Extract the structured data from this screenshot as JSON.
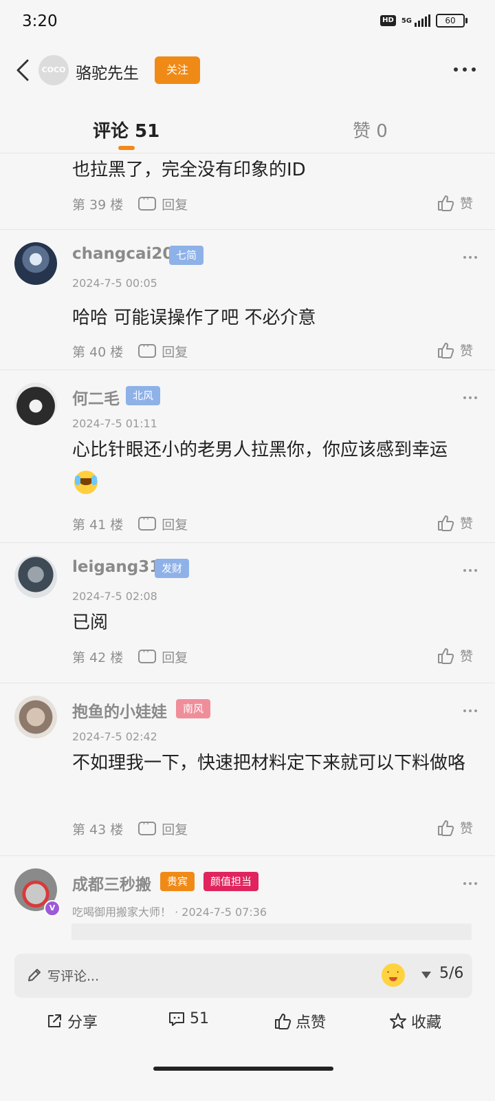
{
  "status_bar": {
    "time": "3:20",
    "hd": "HD",
    "network": "5G",
    "battery": "60"
  },
  "header": {
    "avatar_text": "COCO",
    "username": "骆驼先生",
    "follow_label": "关注"
  },
  "tabs": [
    {
      "label": "评论 51",
      "active": true
    },
    {
      "label": "赞 0",
      "active": false
    }
  ],
  "comments": [
    {
      "text": "也拉黑了，完全没有印象的ID",
      "floor": "第 39 楼",
      "reply": "回复",
      "like": "赞"
    },
    {
      "username": "changcai20",
      "badge": "七简",
      "badge_color": "#8eb1e8",
      "time": "2024-7-5 00:05",
      "text": "哈哈 可能误操作了吧 不必介意",
      "floor": "第 40 楼",
      "reply": "回复",
      "like": "赞"
    },
    {
      "username": "何二毛",
      "badge": "北风",
      "badge_color": "#8eb1e8",
      "time": "2024-7-5 01:11",
      "text": "心比针眼还小的老男人拉黑你，你应该感到幸运",
      "emoji": "laughing-tears-emoji",
      "floor": "第 41 楼",
      "reply": "回复",
      "like": "赞"
    },
    {
      "username": "leigang31",
      "badge": "发财",
      "badge_color": "#8eb1e8",
      "time": "2024-7-5 02:08",
      "text": "已阅",
      "floor": "第 42 楼",
      "reply": "回复",
      "like": "赞"
    },
    {
      "username": "抱鱼的小娃娃",
      "badge": "南风",
      "badge_color": "#ef8e9a",
      "time": "2024-7-5 02:42",
      "text": "不如理我一下，快速把材料定下来就可以下料做咯",
      "floor": "第 43 楼",
      "reply": "回复",
      "like": "赞"
    },
    {
      "username": "成都三秒搬",
      "badge": "贵宾",
      "badge_color": "#f08a16",
      "badge2": "颜值担当",
      "badge2_color": "#e0245e",
      "time": "吃喝御用搬家大师！ · 2024-7-5 07:36"
    }
  ],
  "composer": {
    "placeholder": "写评论...",
    "page": "5/6"
  },
  "actions": {
    "share": "分享",
    "comments": "51",
    "like": "点赞",
    "favorite": "收藏"
  },
  "colors": {
    "accent": "#f08a16",
    "badge_blue": "#8eb1e8",
    "badge_pink": "#ef8e9a",
    "badge_magenta": "#e0245e"
  }
}
